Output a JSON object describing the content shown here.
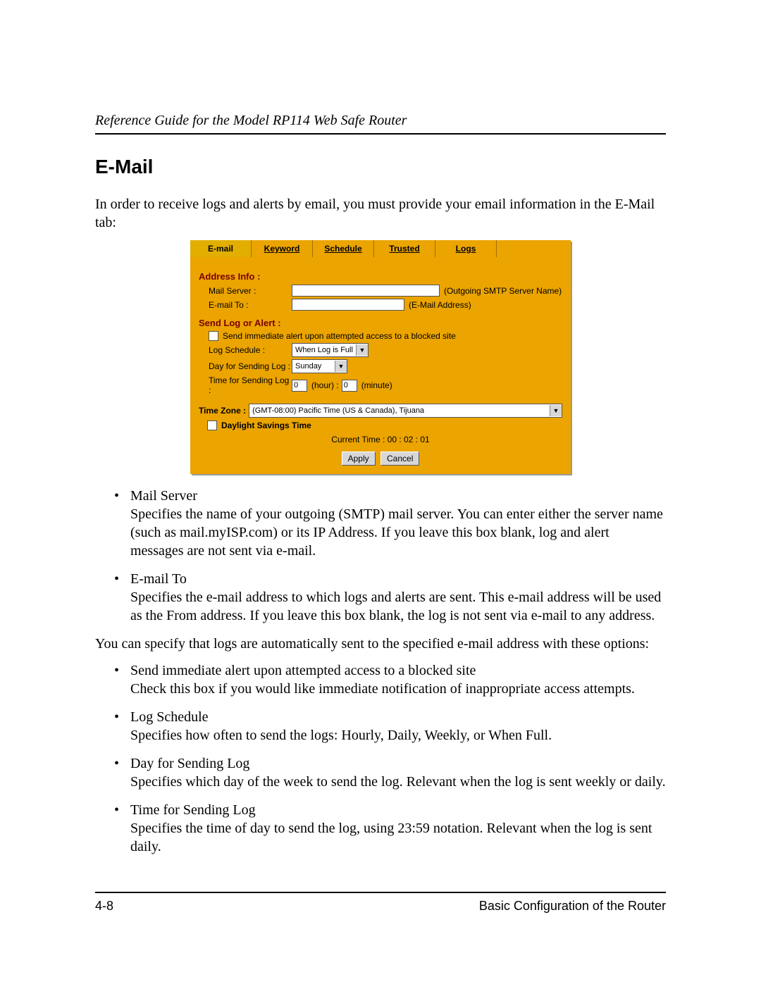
{
  "header": {
    "running": "Reference Guide for the Model RP114 Web Safe Router"
  },
  "section": {
    "title": "E-Mail",
    "intro": "In order to receive logs and alerts by email, you must provide your email information in the E-Mail tab:"
  },
  "panel": {
    "tabs": [
      "E-mail",
      "Keyword",
      "Schedule",
      "Trusted",
      "Logs"
    ],
    "address": {
      "title": "Address Info :",
      "mail_server_label": "Mail Server :",
      "mail_server_value": "",
      "mail_server_note": "(Outgoing SMTP Server Name)",
      "email_to_label": "E-mail To :",
      "email_to_value": "",
      "email_to_note": "(E-Mail Address)"
    },
    "alert": {
      "title": "Send Log or Alert :",
      "immediate_label": "Send immediate alert upon attempted access to a blocked site",
      "schedule_label": "Log Schedule :",
      "schedule_value": "When Log is Full",
      "day_label": "Day for Sending Log :",
      "day_value": "Sunday",
      "time_label": "Time for Sending Log :",
      "hour_value": "0",
      "hour_note": "(hour) :",
      "minute_value": "0",
      "minute_note": "(minute)"
    },
    "timezone": {
      "label": "Time Zone :",
      "value": "(GMT-08:00) Pacific Time (US & Canada), Tijuana",
      "dst_label": "Daylight Savings Time",
      "current_time": "Current Time : 00 : 02 : 01"
    },
    "buttons": {
      "apply": "Apply",
      "cancel": "Cancel"
    }
  },
  "bullets1": [
    {
      "term": "Mail Server",
      "desc": "Specifies the name of your outgoing (SMTP) mail server. You can enter either the server name (such as mail.myISP.com) or its IP Address. If you leave this box blank, log and alert messages are not sent via e-mail."
    },
    {
      "term": "E-mail To",
      "desc": "Specifies the e-mail address to which logs and alerts are sent. This e-mail address will be used as the From address. If you leave this box blank, the log is not sent via e-mail to any address."
    }
  ],
  "mid_para": "You can specify that logs are automatically sent to the specified e-mail address with these options:",
  "bullets2": [
    {
      "term": "Send immediate alert upon attempted access to a blocked site",
      "desc": "Check this box if you would like immediate notification of inappropriate access attempts."
    },
    {
      "term": "Log Schedule",
      "desc": "Specifies how often to send the logs: Hourly, Daily, Weekly, or When Full."
    },
    {
      "term": "Day for Sending Log",
      "desc": "Specifies which day of the week to send the log. Relevant when the log is sent weekly or daily."
    },
    {
      "term": "Time for Sending Log",
      "desc": "Specifies the time of day to send the log, using 23:59 notation. Relevant when the log is sent daily."
    }
  ],
  "footer": {
    "page": "4-8",
    "chapter": "Basic Configuration of the Router"
  }
}
